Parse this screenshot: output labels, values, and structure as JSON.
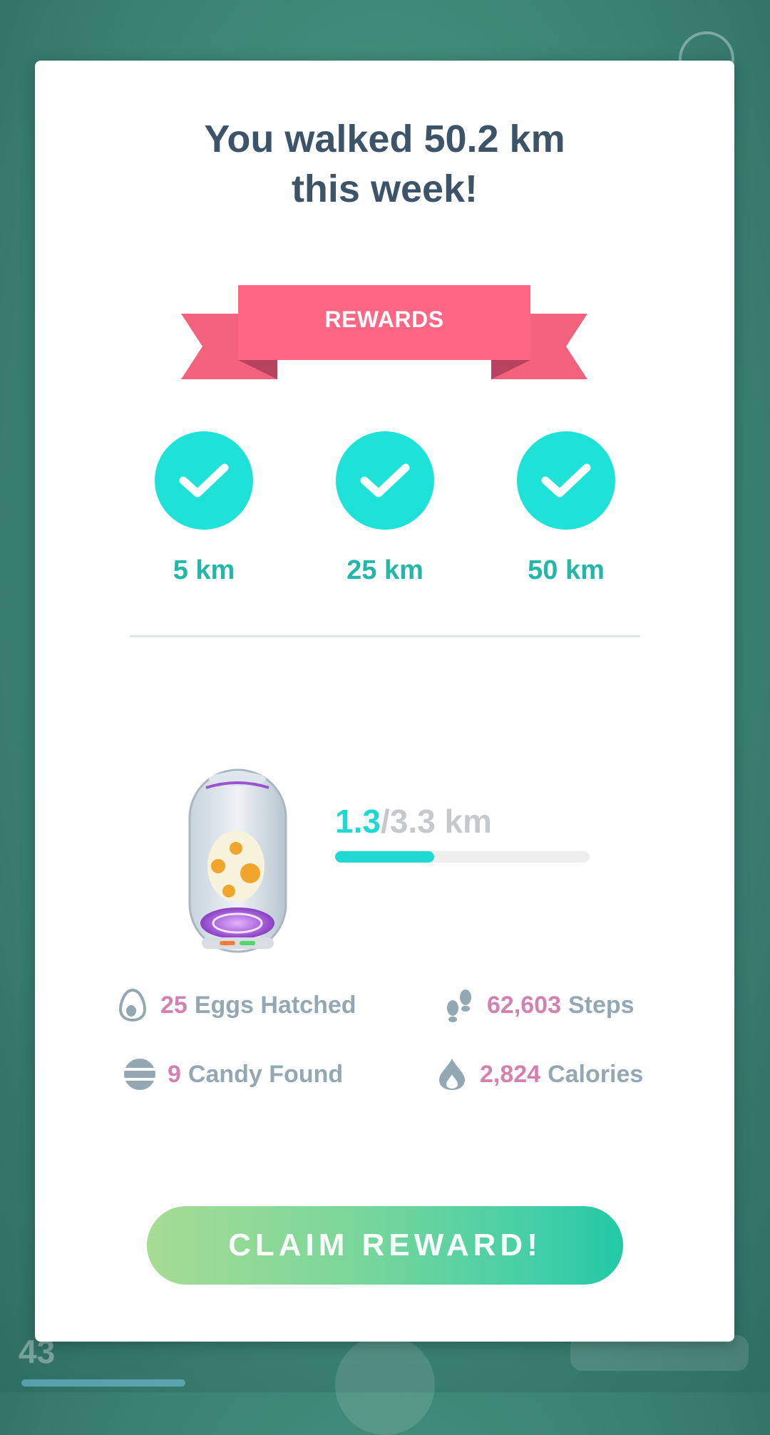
{
  "background": {
    "trainer_level": "43"
  },
  "card": {
    "title_line1": "You walked 50.2 km",
    "title_line2": "this week!",
    "rewards_label": "REWARDS",
    "milestones": [
      {
        "label": "5 km",
        "completed": true
      },
      {
        "label": "25 km",
        "completed": true
      },
      {
        "label": "50 km",
        "completed": true
      }
    ],
    "egg_progress": {
      "current": "1.3",
      "total": "/3.3 km",
      "fraction": 0.39
    },
    "stats": {
      "eggs": {
        "value": "25",
        "label": "Eggs Hatched",
        "icon": "egg-icon"
      },
      "steps": {
        "value": "62,603",
        "label": "Steps",
        "icon": "footsteps-icon"
      },
      "candy": {
        "value": "9",
        "label": "Candy Found",
        "icon": "candy-icon"
      },
      "calories": {
        "value": "2,824",
        "label": "Calories",
        "icon": "flame-icon"
      }
    },
    "claim_label": "CLAIM REWARD!"
  },
  "colors": {
    "accent_teal": "#1ee2d8",
    "ribbon_pink": "#ff6683",
    "stat_number_pink": "#d282ad"
  }
}
